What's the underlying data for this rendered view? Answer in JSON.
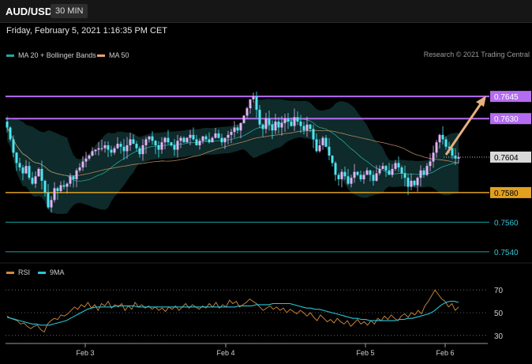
{
  "header": {
    "symbol": "AUD/USD",
    "interval": "30 MIN",
    "datetime": "Friday, February 5, 2021 1:16:35 PM CET"
  },
  "legends": {
    "price": [
      {
        "label": "MA 20 + Bollinger Bands",
        "color": "#26a69a"
      },
      {
        "label": "MA 50",
        "color": "#e8a07a"
      }
    ],
    "rsi": [
      {
        "label": "RSI",
        "color": "#d48a3c"
      },
      {
        "label": "9MA",
        "color": "#26c6da"
      }
    ]
  },
  "credit": "Research © 2021 Trading Central",
  "colors": {
    "bullish": "#e1b4f5",
    "bearish": "#4fe6f2",
    "resistance": "#b46cf0",
    "support": "#e0a020",
    "level": "#17a2a2",
    "arrow": "#e6b07f",
    "band_fill": "#0f2f2f"
  },
  "chart_data": [
    {
      "type": "candlestick",
      "title": "AUD/USD 30 MIN",
      "ylim": [
        0.7533,
        0.766
      ],
      "x_ticks": [
        "Feb 3",
        "Feb 4",
        "Feb 5",
        "Feb 6"
      ],
      "series": [
        {
          "name": "MA 20 + Bollinger Bands"
        },
        {
          "name": "MA 50"
        }
      ],
      "current_price": 0.7604,
      "levels": [
        {
          "value": 0.7645,
          "label": "0.7645",
          "kind": "resistance"
        },
        {
          "value": 0.763,
          "label": "0.7630",
          "kind": "resistance"
        },
        {
          "value": 0.7604,
          "label": "0.7604",
          "kind": "current"
        },
        {
          "value": 0.758,
          "label": "0.7580",
          "kind": "support"
        },
        {
          "value": 0.756,
          "label": "0.7560",
          "kind": "level"
        },
        {
          "value": 0.754,
          "label": "0.7540",
          "kind": "level"
        }
      ],
      "closes": [
        0.7624,
        0.7616,
        0.7607,
        0.76,
        0.7597,
        0.7593,
        0.7598,
        0.759,
        0.7586,
        0.7591,
        0.7596,
        0.7588,
        0.758,
        0.757,
        0.7575,
        0.7583,
        0.7581,
        0.7585,
        0.7584,
        0.7586,
        0.7591,
        0.7589,
        0.7595,
        0.7597,
        0.7601,
        0.7603,
        0.7605,
        0.7608,
        0.7609,
        0.761,
        0.761,
        0.7612,
        0.7609,
        0.7607,
        0.761,
        0.7613,
        0.7611,
        0.7608,
        0.7612,
        0.7616,
        0.7613,
        0.761,
        0.7606,
        0.7612,
        0.7616,
        0.7618,
        0.7615,
        0.7612,
        0.7609,
        0.7614,
        0.7617,
        0.7614,
        0.7612,
        0.7609,
        0.7615,
        0.7617,
        0.7614,
        0.7617,
        0.7619,
        0.7616,
        0.7612,
        0.7615,
        0.7618,
        0.7616,
        0.7614,
        0.7617,
        0.762,
        0.7617,
        0.7614,
        0.7617,
        0.7619,
        0.7621,
        0.7624,
        0.7622,
        0.7627,
        0.7632,
        0.7637,
        0.7643,
        0.7645,
        0.7636,
        0.7626,
        0.7623,
        0.763,
        0.7626,
        0.7622,
        0.7628,
        0.7624,
        0.7627,
        0.763,
        0.7628,
        0.7625,
        0.7631,
        0.7628,
        0.7625,
        0.7622,
        0.7626,
        0.7623,
        0.7616,
        0.7608,
        0.7612,
        0.7617,
        0.7611,
        0.7605,
        0.76,
        0.7592,
        0.7589,
        0.7594,
        0.7591,
        0.7586,
        0.759,
        0.7594,
        0.7592,
        0.7589,
        0.7592,
        0.7595,
        0.7592,
        0.7588,
        0.7593,
        0.7596,
        0.7598,
        0.7595,
        0.7592,
        0.7596,
        0.76,
        0.7597,
        0.7593,
        0.759,
        0.7584,
        0.7588,
        0.7585,
        0.759,
        0.7595,
        0.7592,
        0.7598,
        0.7601,
        0.7607,
        0.7614,
        0.7619,
        0.7616,
        0.7611,
        0.761,
        0.7605,
        0.7603,
        0.7604
      ],
      "rsi": {
        "ylim": [
          25,
          75
        ],
        "ticks": [
          70,
          50,
          30
        ],
        "series": [
          {
            "name": "RSI",
            "values": [
              47,
              45,
              44,
              43,
              40,
              41,
              38,
              36,
              38,
              39,
              35,
              33,
              40,
              43,
              45,
              44,
              48,
              47,
              49,
              52,
              55,
              53,
              57,
              55,
              59,
              54,
              57,
              52,
              58,
              56,
              60,
              54,
              57,
              55,
              58,
              52,
              56,
              53,
              59,
              55,
              57,
              54,
              56,
              53,
              55,
              52,
              54,
              51,
              55,
              53,
              56,
              52,
              55,
              58,
              54,
              57,
              55,
              53,
              56,
              54,
              58,
              55,
              59,
              54,
              57,
              55,
              61,
              58,
              60,
              55,
              57,
              59,
              62,
              60,
              58,
              55,
              52,
              54,
              56,
              53,
              55,
              52,
              54,
              50,
              53,
              51,
              49,
              52,
              50,
              47,
              50,
              46,
              43,
              48,
              45,
              42,
              44,
              41,
              45,
              42,
              40,
              43,
              38,
              41,
              44,
              40,
              42,
              39,
              43,
              40,
              45,
              43,
              47,
              44,
              48,
              45,
              43,
              47,
              49,
              46,
              50,
              48,
              52,
              49,
              56,
              60,
              65,
              70,
              66,
              62,
              60,
              55,
              58,
              52,
              55
            ]
          },
          {
            "name": "9MA",
            "values": [
              46,
              45,
              44,
              43,
              42,
              41,
              40,
              40,
              39,
              39,
              39,
              40,
              41,
              42,
              43,
              45,
              47,
              49,
              51,
              53,
              54,
              55,
              55,
              55,
              55,
              55,
              56,
              56,
              56,
              56,
              56,
              55,
              55,
              55,
              55,
              55,
              55,
              55,
              55,
              55,
              55,
              55,
              55,
              55,
              55,
              55,
              55,
              55,
              55,
              55,
              55,
              55,
              55,
              55,
              55,
              56,
              56,
              56,
              56,
              57,
              57,
              57,
              57,
              58,
              58,
              58,
              58,
              58,
              57,
              56,
              55,
              54,
              54,
              53,
              53,
              52,
              51,
              50,
              49,
              48,
              47,
              46,
              45,
              45,
              44,
              44,
              43,
              43,
              43,
              43,
              43,
              43,
              43,
              44,
              44,
              45,
              45,
              46,
              47,
              48,
              49,
              51,
              54,
              57,
              59,
              60,
              60,
              59
            ]
          }
        ]
      }
    }
  ]
}
